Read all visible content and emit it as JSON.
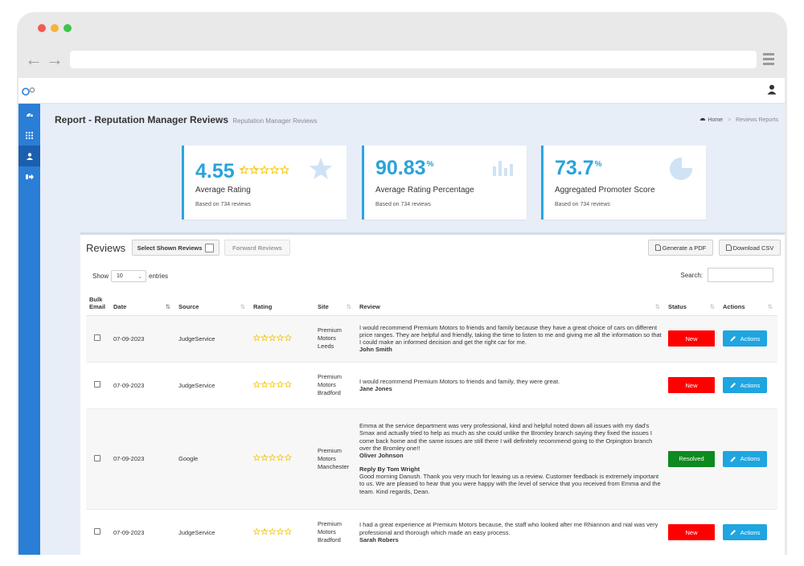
{
  "topbar": {
    "logo_icon": "logo-icon",
    "user_icon": "user-icon"
  },
  "sidebar": {
    "items": [
      {
        "icon": "dashboard-icon"
      },
      {
        "icon": "grid-icon"
      },
      {
        "icon": "user-icon",
        "active": true
      },
      {
        "icon": "sign-out-icon"
      }
    ]
  },
  "header": {
    "title": "Report - Reputation Manager Reviews",
    "subtitle": "Reputation Manager Reviews",
    "breadcrumb": {
      "home": "Home",
      "current": "Reviews Reports"
    }
  },
  "stats": [
    {
      "value": "4.55",
      "suffix": "",
      "label": "Average Rating",
      "sub": "Based on 734 reviews",
      "icon": "star-icon",
      "stars": 4.5
    },
    {
      "value": "90.83",
      "suffix": "%",
      "label": "Average Rating Percentage",
      "sub": "Based on 734 reviews",
      "icon": "bar-chart-icon"
    },
    {
      "value": "73.7",
      "suffix": "%",
      "label": "Aggregated Promoter Score",
      "sub": "Based on 734 reviews",
      "icon": "pie-chart-icon"
    }
  ],
  "reviews_panel": {
    "title": "Reviews",
    "select_shown": "Select Shown Reviews",
    "forward": "Forward Reviews",
    "pdf": "Generate a PDF",
    "csv": "Download CSV",
    "show": "Show",
    "entries_value": "10",
    "entries": "entries",
    "search": "Search:",
    "columns": {
      "bulk1": "Bulk",
      "bulk2": "Email",
      "date": "Date",
      "source": "Source",
      "rating": "Rating",
      "site": "Site",
      "review": "Review",
      "status": "Status",
      "actions": "Actions"
    },
    "rows": [
      {
        "date": "07-09-2023",
        "source": "JudgeService",
        "rating": 5,
        "site": [
          "Premium",
          "Motors",
          "Leeds"
        ],
        "review": "I would recommend Premium Motors to friends and family because they have a great choice of cars on different price ranges. They are helpful and friendly, taking the time to listen to me and giving me all the information so that I could make an informed decision and get the right car for me.",
        "author": "John Smith",
        "reply_by": "",
        "reply": "",
        "status": "New",
        "action": "Actions"
      },
      {
        "date": "07-09-2023",
        "source": "JudgeService",
        "rating": 5,
        "site": [
          "Premium",
          "Motors",
          "Bradford"
        ],
        "review": "I would recommend Premium Motors to friends and family, they were great.",
        "author": "Jane Jones",
        "reply_by": "",
        "reply": "",
        "status": "New",
        "action": "Actions"
      },
      {
        "date": "07-09-2023",
        "source": "Google",
        "rating": 5,
        "site": [
          "Premium",
          "Motors",
          "Manchester"
        ],
        "review": "Emma at the service department was very professional, kind and helpful noted down all issues with my dad's Smax and actually tried to help as much as she could unlike the Bromley branch saying they fixed the issues I come back home and the same issues are still there I will definitely recommend going to the Orpington branch over the Bromley one!!",
        "author": "Oliver Johnson",
        "reply_by": "Reply By Tom Wright",
        "reply": "Good morning Danush. Thank you very much for leaving us a review. Customer feedback is extremely important to us. We are pleased to hear that you were happy with the level of service that you received from Emma and the team. Kind regards, Dean.",
        "status": "Resolved",
        "action": "Actions"
      },
      {
        "date": "07-09-2023",
        "source": "JudgeService",
        "rating": 5,
        "site": [
          "Premium",
          "Motors",
          "Bradford"
        ],
        "review": "I had a great experience at Premium Motors because, the staff who looked after me Rhiannon and nial was very professional and thorough which made an easy process.",
        "author": "Sarah Robers",
        "reply_by": "",
        "reply": "",
        "status": "New",
        "action": "Actions"
      }
    ]
  },
  "colors": {
    "accent": "#29a3dc",
    "sidebar": "#2a7ed6",
    "new": "#ff0000",
    "resolved": "#0e8a1f",
    "star": "#f5c400"
  }
}
